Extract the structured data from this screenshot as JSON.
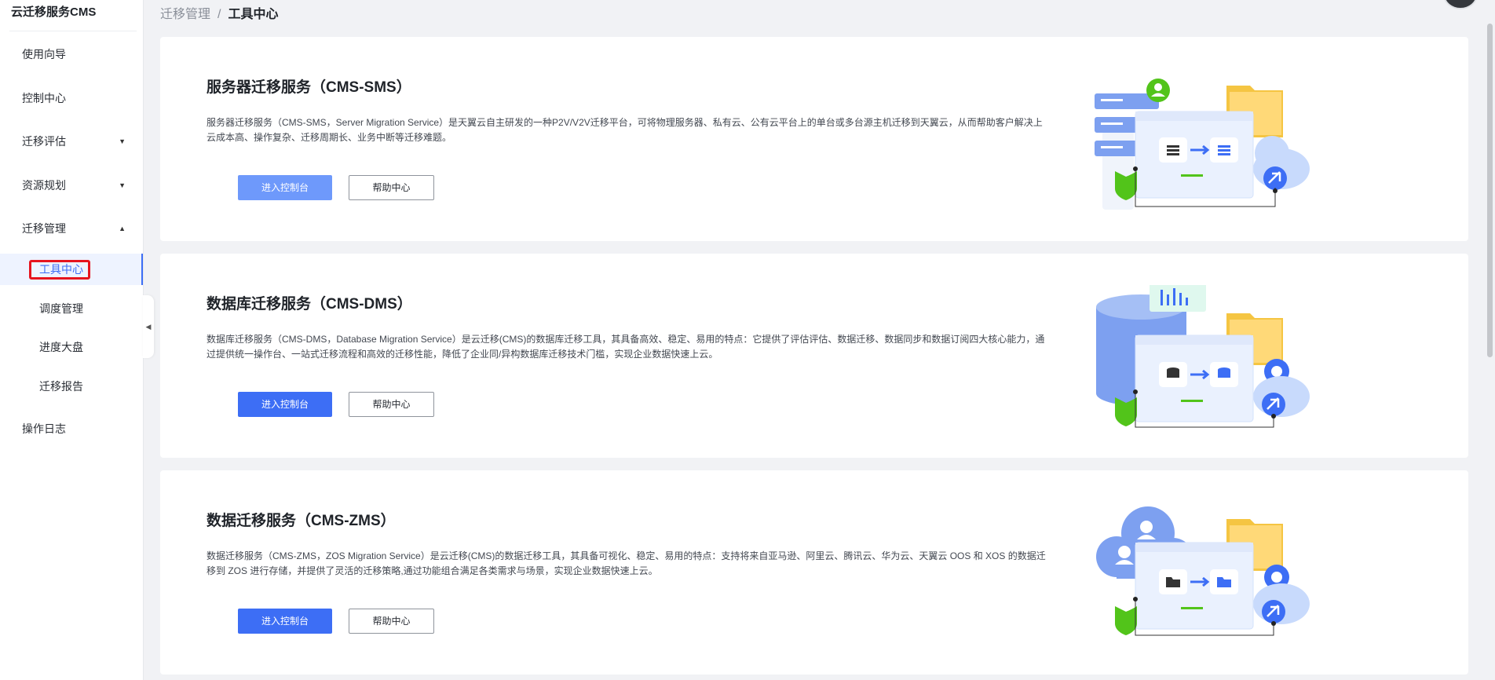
{
  "app": {
    "title": "云迁移服务CMS"
  },
  "sidebar": {
    "items": [
      {
        "label": "使用向导"
      },
      {
        "label": "控制中心"
      },
      {
        "label": "迁移评估",
        "caret": "▼"
      },
      {
        "label": "资源规划",
        "caret": "▼"
      },
      {
        "label": "迁移管理",
        "caret": "▲"
      },
      {
        "label": "工具中心",
        "active": true
      },
      {
        "label": "调度管理"
      },
      {
        "label": "进度大盘"
      },
      {
        "label": "迁移报告"
      },
      {
        "label": "操作日志"
      }
    ],
    "collapse_glyph": "◀"
  },
  "breadcrumb": {
    "parent": "迁移管理",
    "separator": "/",
    "current": "工具中心"
  },
  "cards": [
    {
      "title": "服务器迁移服务（CMS-SMS）",
      "description": "服务器迁移服务（CMS-SMS，Server Migration Service）是天翼云自主研发的一种P2V/V2V迁移平台，可将物理服务器、私有云、公有云平台上的单台或多台源主机迁移到天翼云，从而帮助客户解决上云成本高、操作复杂、迁移周期长、业务中断等迁移难题。",
      "primary_label": "进入控制台",
      "secondary_label": "帮助中心",
      "illustration": "server-migration-illustration"
    },
    {
      "title": "数据库迁移服务（CMS-DMS）",
      "description": "数据库迁移服务（CMS-DMS，Database Migration Service）是云迁移(CMS)的数据库迁移工具，其具备高效、稳定、易用的特点：它提供了评估评估、数据迁移、数据同步和数据订阅四大核心能力，通过提供统一操作台、一站式迁移流程和高效的迁移性能，降低了企业同/异构数据库迁移技术门槛，实现企业数据快速上云。",
      "primary_label": "进入控制台",
      "secondary_label": "帮助中心",
      "illustration": "database-migration-illustration"
    },
    {
      "title": "数据迁移服务（CMS-ZMS）",
      "description": "数据迁移服务（CMS-ZMS，ZOS Migration Service）是云迁移(CMS)的数据迁移工具，其具备可视化、稳定、易用的特点：支持将来自亚马逊、阿里云、腾讯云、华为云、天翼云 OOS 和 XOS 的数据迁移到 ZOS 进行存储，并提供了灵活的迁移策略,通过功能组合满足各类需求与场景，实现企业数据快速上云。",
      "primary_label": "进入控制台",
      "secondary_label": "帮助中心",
      "illustration": "data-migration-illustration"
    }
  ],
  "colors": {
    "primary": "#3d6ef5",
    "primary_light": "#6e99fb",
    "highlight": "#e6141e",
    "green": "#52c41a",
    "folder": "#f5c542"
  }
}
